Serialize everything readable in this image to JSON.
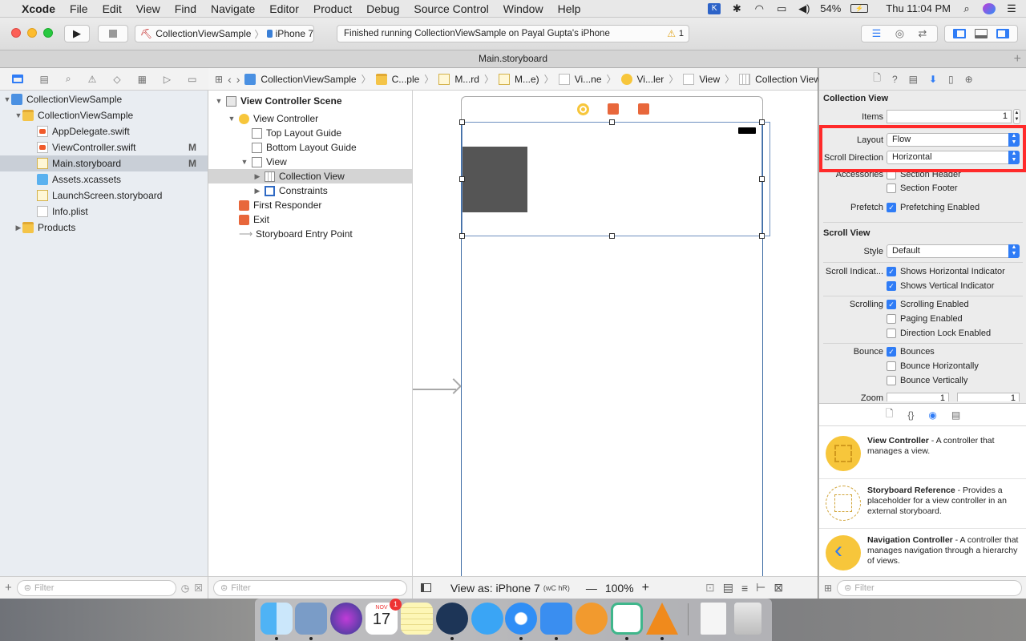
{
  "menubar": {
    "app": "Xcode",
    "items": [
      "File",
      "Edit",
      "View",
      "Find",
      "Navigate",
      "Editor",
      "Product",
      "Debug",
      "Source Control",
      "Window",
      "Help"
    ],
    "battery": "54%",
    "clock": "Thu 11:04 PM"
  },
  "toolbar": {
    "scheme": "CollectionViewSample",
    "device": "iPhone 7",
    "status": "Finished running CollectionViewSample on Payal Gupta's iPhone",
    "warning_count": "1"
  },
  "tab": {
    "title": "Main.storyboard"
  },
  "navigator": {
    "items": [
      {
        "label": "CollectionViewSample",
        "badge": ""
      },
      {
        "label": "CollectionViewSample",
        "badge": ""
      },
      {
        "label": "AppDelegate.swift",
        "badge": ""
      },
      {
        "label": "ViewController.swift",
        "badge": "M"
      },
      {
        "label": "Main.storyboard",
        "badge": "M"
      },
      {
        "label": "Assets.xcassets",
        "badge": ""
      },
      {
        "label": "LaunchScreen.storyboard",
        "badge": ""
      },
      {
        "label": "Info.plist",
        "badge": ""
      },
      {
        "label": "Products",
        "badge": ""
      }
    ],
    "filter_placeholder": "Filter"
  },
  "jumpbar": {
    "crumbs": [
      "CollectionViewSample",
      "C...ple",
      "M...rd",
      "M...e)",
      "Vi...ne",
      "Vi...ler",
      "View",
      "Collection View"
    ]
  },
  "outline": {
    "items": [
      "View Controller Scene",
      "View Controller",
      "Top Layout Guide",
      "Bottom Layout Guide",
      "View",
      "Collection View",
      "Constraints",
      "First Responder",
      "Exit",
      "Storyboard Entry Point"
    ],
    "filter_placeholder": "Filter"
  },
  "canvas_bottom": {
    "view_as": "View as: iPhone 7",
    "size_class": "(wC hR)",
    "zoom": "100%"
  },
  "inspector": {
    "collection_view": {
      "title": "Collection View",
      "items_label": "Items",
      "items_value": "1",
      "layout_label": "Layout",
      "layout_value": "Flow",
      "scroll_direction_label": "Scroll Direction",
      "scroll_direction_value": "Horizontal",
      "accessories_label": "Accessories",
      "section_header": "Section Header",
      "section_footer": "Section Footer",
      "prefetch_label": "Prefetch",
      "prefetching_enabled": "Prefetching Enabled"
    },
    "scroll_view": {
      "title": "Scroll View",
      "style_label": "Style",
      "style_value": "Default",
      "indicators_label": "Scroll Indicat...",
      "shows_horizontal": "Shows Horizontal Indicator",
      "shows_vertical": "Shows Vertical Indicator",
      "scrolling_label": "Scrolling",
      "scrolling_enabled": "Scrolling Enabled",
      "paging_enabled": "Paging Enabled",
      "direction_lock": "Direction Lock Enabled",
      "bounce_label": "Bounce",
      "bounces": "Bounces",
      "bounce_horizontally": "Bounce Horizontally",
      "bounce_vertically": "Bounce Vertically",
      "zoom_label": "Zoom",
      "zoom_min": "1",
      "zoom_max": "1"
    },
    "checks": {
      "section_header": false,
      "section_footer": false,
      "prefetching": true,
      "shows_horizontal": true,
      "shows_vertical": true,
      "scrolling": true,
      "paging": false,
      "direction_lock": false,
      "bounces": true,
      "bounce_h": false,
      "bounce_v": false
    },
    "highlight_color": "#ff2a2a"
  },
  "library": {
    "items": [
      {
        "title": "View Controller",
        "desc": " - A controller that manages a view."
      },
      {
        "title": "Storyboard Reference",
        "desc": " - Provides a placeholder for a view controller in an external storyboard."
      },
      {
        "title": "Navigation Controller",
        "desc": " - A controller that manages navigation through a hierarchy of views."
      }
    ],
    "filter_placeholder": "Filter"
  },
  "dock": {
    "calendar_month": "NOV",
    "calendar_day": "17",
    "calendar_badge": "1"
  }
}
